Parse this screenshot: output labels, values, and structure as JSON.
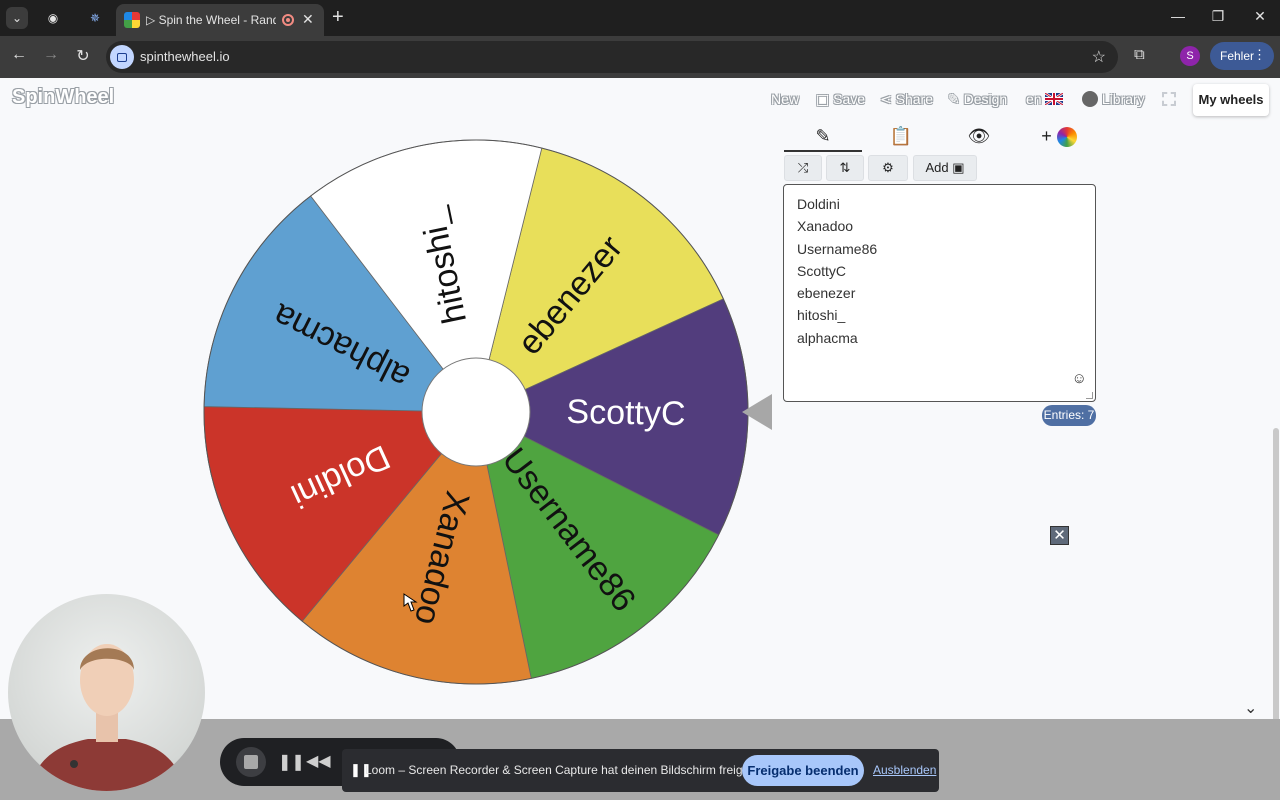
{
  "browser": {
    "tab_title": "▷ Spin the Wheel - Random",
    "new_tab_icon": "plus-icon",
    "url": "spinthewheel.io",
    "profile_initial": "S",
    "profile_label": "Fehler"
  },
  "header": {
    "logo": "SpinWheel",
    "menu": [
      "New",
      "Save",
      "Share",
      "Design",
      "en",
      "Library"
    ],
    "my_wheels": "My wheels"
  },
  "wheel": {
    "segments": [
      {
        "label": "ebenezer",
        "color": "#e8df5a"
      },
      {
        "label": "ScottyC",
        "color": "#523d7d"
      },
      {
        "label": "Username86",
        "color": "#4fa440"
      },
      {
        "label": "Xanadoo",
        "color": "#de8331"
      },
      {
        "label": "Doldini",
        "color": "#cb3429"
      },
      {
        "label": "alphacma",
        "color": "#5fa0d1"
      },
      {
        "label": "hitoshi_",
        "color": "#ffffff"
      }
    ]
  },
  "panel": {
    "tabs": [
      "edit-icon",
      "clipboard-icon",
      "eye-off-icon",
      "add-color-icon"
    ],
    "tools": [
      "shuffle-icon",
      "sort-icon",
      "settings-icon"
    ],
    "add_label": "Add",
    "entries": [
      "Doldini",
      "Xanadoo",
      "Username86",
      "ScottyC",
      "ebenezer",
      "hitoshi_",
      "alphacma"
    ],
    "entries_count": "Entries: 7"
  },
  "loom": {
    "message": "Loom – Screen Recorder & Screen Capture hat deinen Bildschirm freigegeben.",
    "stop_sharing": "Freigabe beenden",
    "hide": "Ausblenden"
  }
}
